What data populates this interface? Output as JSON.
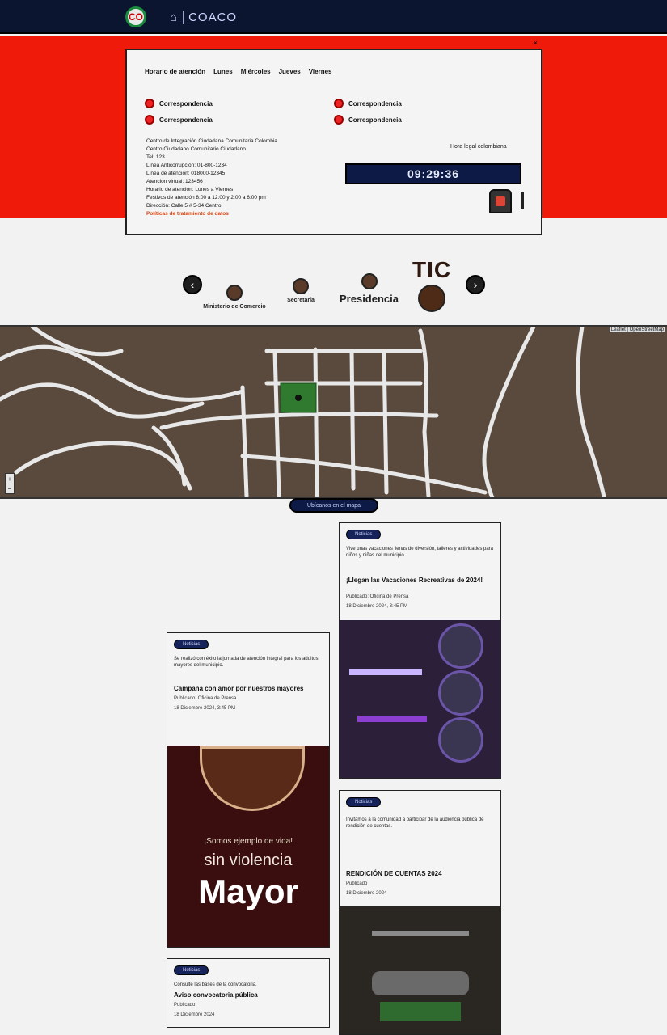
{
  "nav": {
    "logo_text": "CO",
    "brand": "COACO"
  },
  "hero": {
    "close_label": "×",
    "schedule_line": [
      "Horario de atención",
      "Lunes",
      "Miércoles",
      "Jueves",
      "Viernes"
    ],
    "links": [
      "Correspondencia",
      "Correspondencia",
      "Correspondencia",
      "Correspondencia"
    ],
    "info_lines": [
      "Centro de Integración Ciudadana Comunitaria Colombia",
      "Centro Ciudadano Comunitario Ciudadano",
      "Tel: 123",
      "Línea Anticorrupción: 01-800-1234",
      "Línea de atención: 018000-12345",
      "Atención virtual: 123456",
      "Horario de atención: Lunes a Viernes",
      "Festivos de atención 8:00 a 12:00 y 2:00 a 6:00 pm",
      "Dirección: Calle 5 # 5-34 Centro"
    ],
    "info_link": "Políticas de tratamiento de datos",
    "clock_caption": "Hora legal colombiana",
    "clock": "09:29:36"
  },
  "carousel": {
    "prev": "‹",
    "next": "›",
    "items": [
      "TIC",
      "Presidencia",
      "Secretaría",
      "Ministerio de Comercio"
    ]
  },
  "map": {
    "attribution": "Leaflet | OpenStreetMap",
    "zoom_in": "+",
    "zoom_out": "−",
    "button": "Ubícanos en el mapa"
  },
  "news": [
    {
      "tag": "Noticias",
      "title": "¡Llegan las Vacaciones Recreativas de 2024!",
      "text": "Vive unas vacaciones llenas de diversión, talleres y actividades para niños y niñas del municipio.",
      "meta": "18 Diciembre 2024, 3:45 PM",
      "author": "Publicado: Oficina de Prensa"
    },
    {
      "tag": "Noticias",
      "title": "Campaña con amor por nuestros mayores",
      "text": "Se realizó con éxito la jornada de atención integral para los adultos mayores del municipio.",
      "meta": "18 Diciembre 2024, 3:45 PM",
      "author": "Publicado: Oficina de Prensa"
    },
    {
      "tag": "Noticias",
      "title": "RENDICIÓN DE CUENTAS 2024",
      "text": "Invitamos a la comunidad a participar de la audiencia pública de rendición de cuentas.",
      "meta": "18 Diciembre 2024",
      "author": "Publicado"
    },
    {
      "tag": "Noticias",
      "title": "Aviso convocatoria pública",
      "text": "Consulte las bases de la convocatoria.",
      "meta": "18 Diciembre 2024",
      "author": "Publicado"
    }
  ],
  "poster": {
    "big": "Mayor",
    "sub": "sin violencia",
    "tagline": "¡Somos ejemplo de",
    "tagline2": "vida!"
  }
}
